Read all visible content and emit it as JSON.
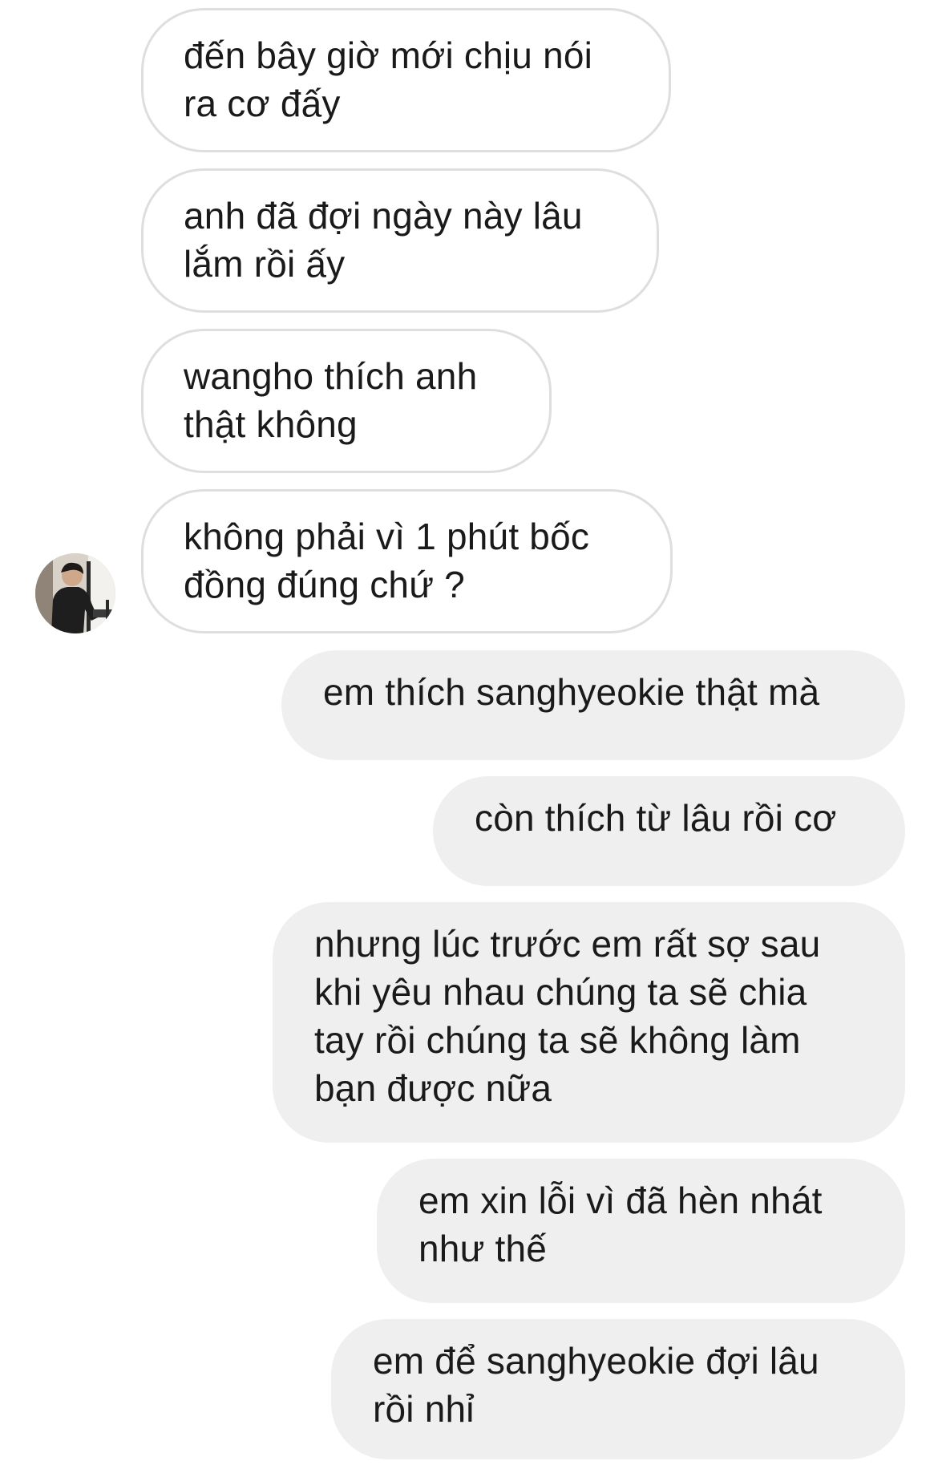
{
  "conversation": {
    "incoming": [
      {
        "text": "đến bây giờ mới chịu nói\nra cơ đấy"
      },
      {
        "text": "anh đã đợi ngày này lâu\nlắm rồi ấy"
      },
      {
        "text": "wangho thích anh\nthật không"
      },
      {
        "text": "không phải vì 1 phút bốc\nđồng đúng chứ ?"
      }
    ],
    "outgoing": [
      {
        "text": "em thích sanghyeokie thật mà"
      },
      {
        "text": "còn thích từ lâu rồi cơ"
      },
      {
        "text": "nhưng lúc trước em rất sợ sau\nkhi yêu nhau chúng ta sẽ chia\ntay rồi chúng ta sẽ không làm\nbạn được nữa"
      },
      {
        "text": "em xin lỗi vì đã hèn nhát\nnhư thế"
      },
      {
        "text": "em để sanghyeokie đợi lâu\nrồi nhỉ"
      }
    ]
  },
  "colors": {
    "incoming_bubble": "#ffffff",
    "incoming_border": "#dedede",
    "outgoing_bubble": "#efefef",
    "text": "#1a1a1a"
  },
  "icons": {
    "avatar": "contact-avatar-photo"
  }
}
